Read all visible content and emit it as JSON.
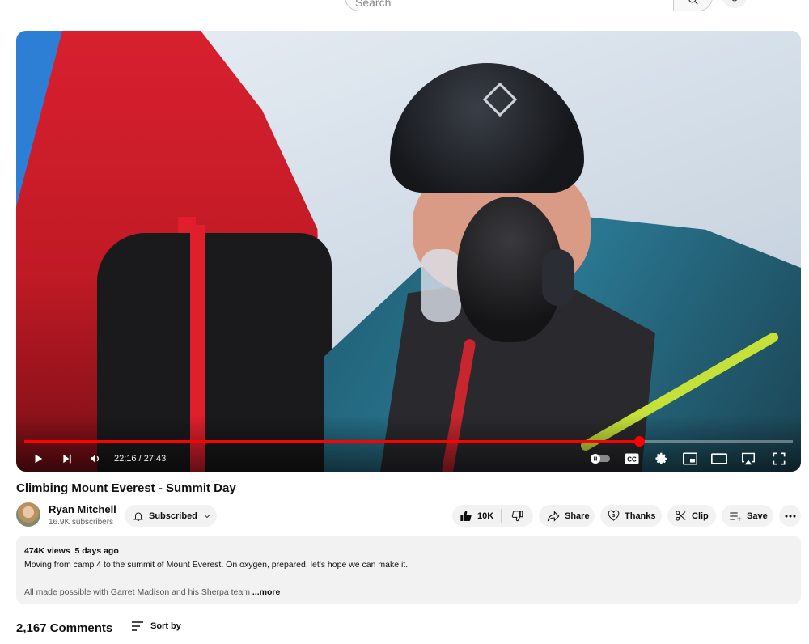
{
  "search": {
    "placeholder": "Search"
  },
  "player": {
    "current_time": "22:16",
    "duration": "27:43",
    "time_display": "22:16 / 27:43",
    "progress_fraction": 0.8,
    "accent_color": "#ff0000"
  },
  "video": {
    "title": "Climbing Mount Everest - Summit Day"
  },
  "channel": {
    "name": "Ryan Mitchell",
    "subscribers": "16.9K subscribers",
    "subscribe_label": "Subscribed"
  },
  "actions": {
    "like_count": "10K",
    "share_label": "Share",
    "thanks_label": "Thanks",
    "clip_label": "Clip",
    "save_label": "Save"
  },
  "description": {
    "views": "474K views",
    "age": "5 days ago",
    "line1": "Moving from camp 4 to the summit of Mount Everest. On oxygen, prepared, let's hope we can make it.",
    "line2": "All made possible with Garret Madison and his Sherpa team",
    "more_label": "...more"
  },
  "comments": {
    "count_label": "2,167 Comments",
    "sort_label": "Sort by"
  },
  "icons": {
    "search": "search-icon",
    "mic": "mic-icon",
    "play": "play-icon",
    "next": "next-icon",
    "volume": "volume-icon",
    "autoplay": "autoplay-toggle-icon",
    "cc": "cc-icon",
    "settings": "gear-icon",
    "miniplayer": "miniplayer-icon",
    "theater": "theater-icon",
    "airplay": "airplay-icon",
    "fullscreen": "fullscreen-icon",
    "bell": "bell-icon",
    "like": "thumbs-up-icon",
    "dislike": "thumbs-down-icon",
    "share": "share-icon",
    "thanks": "thanks-icon",
    "clip": "scissors-icon",
    "save": "save-playlist-icon",
    "more": "more-horizontal-icon",
    "sort": "sort-icon"
  }
}
